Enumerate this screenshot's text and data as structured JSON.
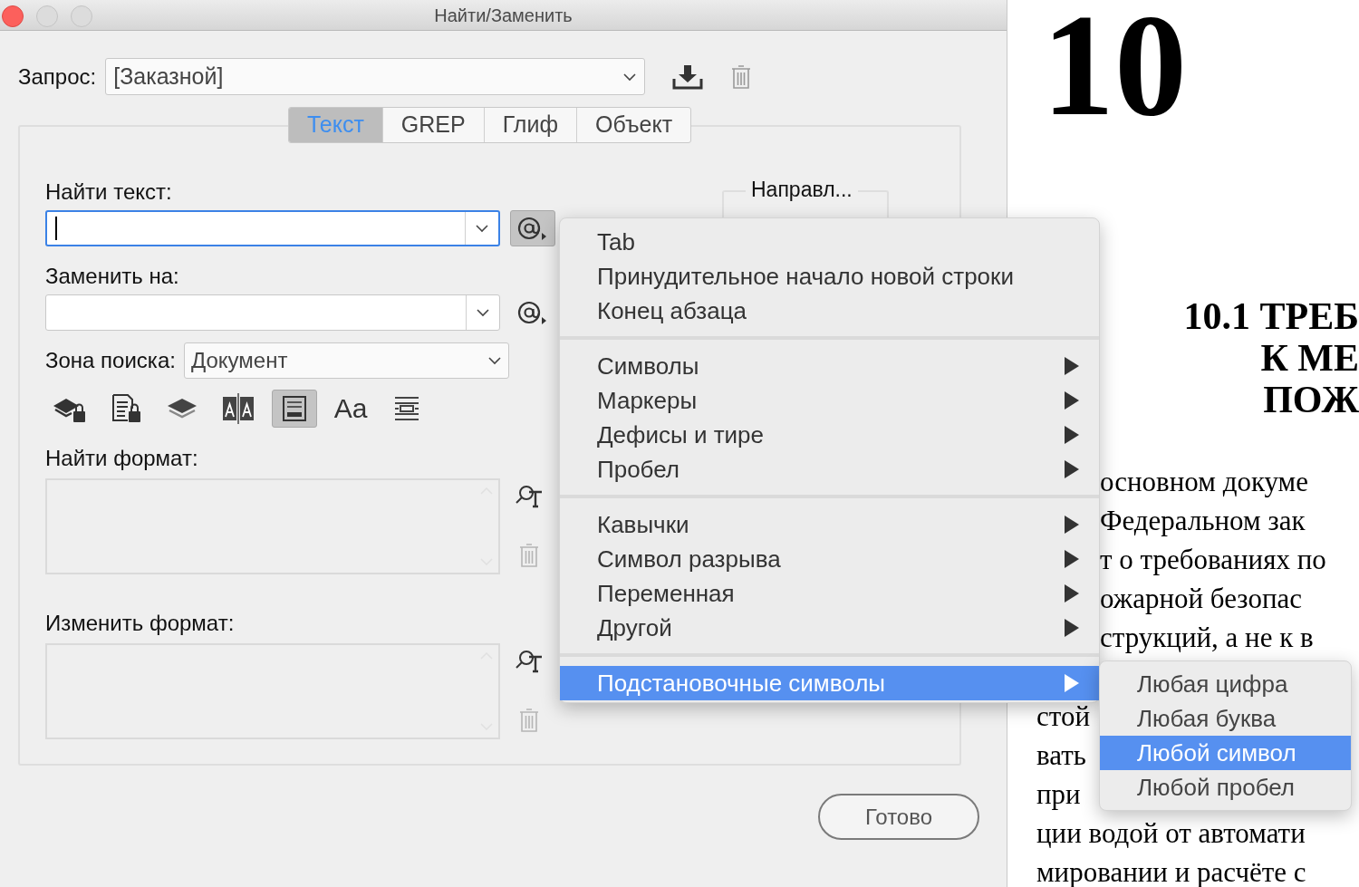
{
  "window": {
    "title": "Найти/Заменить"
  },
  "query": {
    "label": "Запрос:",
    "value": "[Заказной]"
  },
  "tabs": [
    {
      "label": "Текст",
      "selected": true
    },
    {
      "label": "GREP",
      "selected": false
    },
    {
      "label": "Глиф",
      "selected": false
    },
    {
      "label": "Объект",
      "selected": false
    }
  ],
  "find_text": {
    "label": "Найти текст:",
    "focused": true,
    "special_pressed": true
  },
  "replace_with": {
    "label": "Заменить на:",
    "focused": false,
    "special_pressed": false
  },
  "direction": {
    "label": "Направл..."
  },
  "search_zone": {
    "label": "Зона поиска:",
    "value": "Документ"
  },
  "options": [
    {
      "kind": "locked-layers",
      "selected": false
    },
    {
      "kind": "locked-stories",
      "selected": false
    },
    {
      "kind": "hidden-layers",
      "selected": false
    },
    {
      "kind": "master-pages",
      "selected": false
    },
    {
      "kind": "footnotes",
      "selected": true
    },
    {
      "kind": "case",
      "label": "Aa",
      "selected": false
    },
    {
      "kind": "whole-word",
      "selected": false
    }
  ],
  "find_format": {
    "label": "Найти формат:"
  },
  "change_format": {
    "label": "Изменить формат:"
  },
  "done_button": "Готово",
  "menu": {
    "sections": [
      {
        "items": [
          {
            "label": "Tab",
            "submenu": false,
            "selected": false
          },
          {
            "label": "Принудительное начало новой строки",
            "submenu": false,
            "selected": false
          },
          {
            "label": "Конец абзаца",
            "submenu": false,
            "selected": false
          }
        ]
      },
      {
        "items": [
          {
            "label": "Символы",
            "submenu": true,
            "selected": false
          },
          {
            "label": "Маркеры",
            "submenu": true,
            "selected": false
          },
          {
            "label": "Дефисы и тире",
            "submenu": true,
            "selected": false
          },
          {
            "label": "Пробел",
            "submenu": true,
            "selected": false
          }
        ]
      },
      {
        "items": [
          {
            "label": "Кавычки",
            "submenu": true,
            "selected": false
          },
          {
            "label": "Символ разрыва",
            "submenu": true,
            "selected": false
          },
          {
            "label": "Переменная",
            "submenu": true,
            "selected": false
          },
          {
            "label": "Другой",
            "submenu": true,
            "selected": false
          }
        ]
      },
      {
        "items": [
          {
            "label": "Подстановочные символы",
            "submenu": true,
            "selected": true
          }
        ]
      }
    ]
  },
  "submenu": {
    "items": [
      {
        "label": "Любая цифра",
        "selected": false
      },
      {
        "label": "Любая буква",
        "selected": false
      },
      {
        "label": "Любой символ",
        "selected": true
      },
      {
        "label": "Любой пробел",
        "selected": false
      }
    ]
  },
  "document": {
    "chapter": "10",
    "heading": [
      "10.1 ТРЕБ",
      "К МЕ",
      "ПОЖ"
    ],
    "lines_above": [
      "основном докуме",
      "Федеральном зак",
      "т о требованиях по",
      "ожарной безопас",
      "струкций, а не к в"
    ],
    "lines_below": [
      "стой",
      "вать",
      "при",
      "ции водой от автомати",
      "мировании и расчёте с"
    ]
  }
}
